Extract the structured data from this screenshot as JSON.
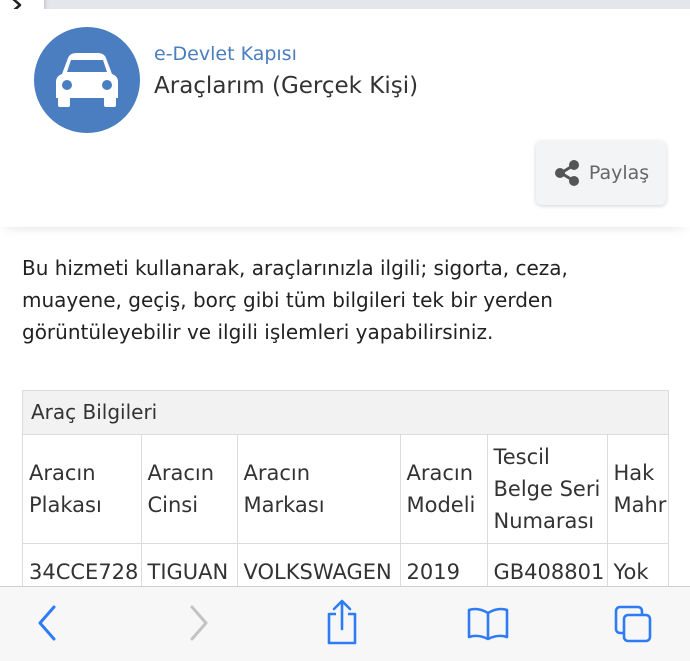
{
  "header": {
    "portal_name": "e-Devlet Kapısı",
    "service_title": "Araçlarım (Gerçek Kişi)",
    "share_label": "Paylaş"
  },
  "description": "Bu hizmeti kullanarak, araçlarınızla ilgili; sigorta, ceza, muayene, geçiş, borç gibi tüm bilgileri tek bir yerden görüntüleyebilir ve ilgili işlemleri yapabilirsiniz.",
  "table": {
    "caption": "Araç Bilgileri",
    "headers": [
      [
        "Aracın",
        "Plakası"
      ],
      [
        "Aracın",
        "Cinsi"
      ],
      [
        "Aracın",
        "Markası"
      ],
      [
        "Aracın",
        "Modeli"
      ],
      [
        "Tescil",
        "Belge Seri",
        "Numarası"
      ],
      [
        "Hak",
        "Mahr"
      ]
    ],
    "rows": [
      [
        "34CCE728",
        "TIGUAN",
        "VOLKSWAGEN",
        "2019",
        "GB408801",
        "Yok"
      ]
    ]
  },
  "colors": {
    "accent": "#4a7ec0",
    "toolbar_active": "#2d7cf6",
    "toolbar_disabled": "#c3c3c3"
  },
  "icons": {
    "service": "car-icon",
    "share": "share-icon",
    "back": "chevron-left-icon",
    "forward": "chevron-right-icon",
    "share_sheet": "share-sheet-icon",
    "bookmarks": "book-icon",
    "tabs": "tabs-icon",
    "corner": "chevron-right-icon"
  }
}
